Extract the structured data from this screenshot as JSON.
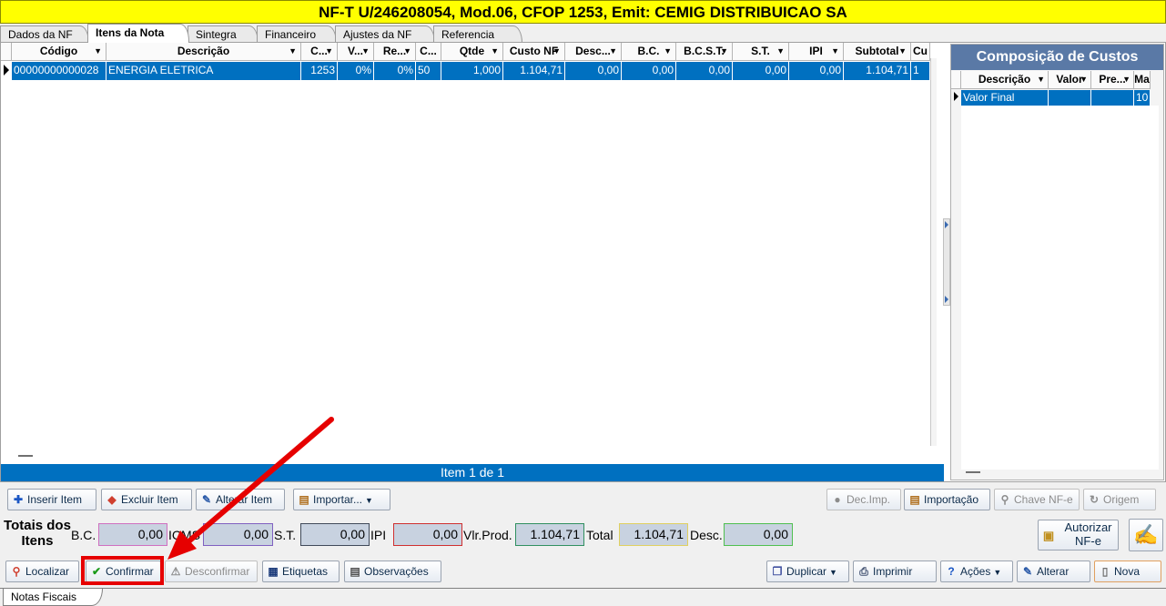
{
  "title": "NF-T U/246208054, Mod.06, CFOP 1253, Emit: CEMIG DISTRIBUICAO SA",
  "tabs": [
    "Dados da NF",
    "Itens da Nota",
    "Sintegra",
    "Financeiro",
    "Ajustes da NF",
    "Referencia"
  ],
  "grid": {
    "columns": [
      "Código",
      "Descrição",
      "C...",
      "V...",
      "Re...",
      "C...",
      "Qtde",
      "Custo NF",
      "Desc...",
      "B.C.",
      "B.C.S.T.",
      "S.T.",
      "IPI",
      "Subtotal",
      "Cu"
    ],
    "rows": [
      [
        "00000000000028",
        "ENERGIA ELETRICA",
        "1253",
        "0%",
        "0%",
        "50",
        "1,000",
        "1.104,71",
        "0,00",
        "0,00",
        "0,00",
        "0,00",
        "0,00",
        "1.104,71",
        "1"
      ]
    ],
    "status": "Item 1 de 1"
  },
  "panel": {
    "title": "Composição de Custos",
    "columns": [
      "Descrição",
      "Valor",
      "Pre...",
      "Ma"
    ],
    "rows": [
      [
        "Valor Final",
        "",
        "",
        "10"
      ]
    ]
  },
  "actions": {
    "inserir": "Inserir Item",
    "excluir": "Excluir Item",
    "alterar_item": "Alterar Item",
    "importar": "Importar...",
    "dec_imp": "Dec.Imp.",
    "importacao": "Importação",
    "chave_nfe": "Chave NF-e",
    "origem": "Origem"
  },
  "totals": {
    "heading": "Totais dos Itens",
    "bc_label": "B.C.",
    "bc": "0,00",
    "icms_label": "ICMS",
    "icms": "0,00",
    "st_label": "S.T.",
    "st": "0,00",
    "ipi_label": "IPI",
    "ipi": "0,00",
    "vlrprod_label": "Vlr.Prod.",
    "vlrprod": "1.104,71",
    "total_label": "Total",
    "total": "1.104,71",
    "desc_label": "Desc.",
    "desc": "0,00"
  },
  "autorizar": "Autorizar NF-e",
  "bottom": {
    "localizar": "Localizar",
    "confirmar": "Confirmar",
    "desconfirmar": "Desconfirmar",
    "etiquetas": "Etiquetas",
    "observacoes": "Observações",
    "duplicar": "Duplicar",
    "imprimir": "Imprimir",
    "acoes": "Ações",
    "alterar": "Alterar",
    "nova": "Nova"
  },
  "bottom_tab": "Notas Fiscais",
  "colors": {
    "title_bg": "#ffff00",
    "selection": "#0070c0",
    "panel_title": "#5a79a6",
    "highlight": "#e60000"
  }
}
